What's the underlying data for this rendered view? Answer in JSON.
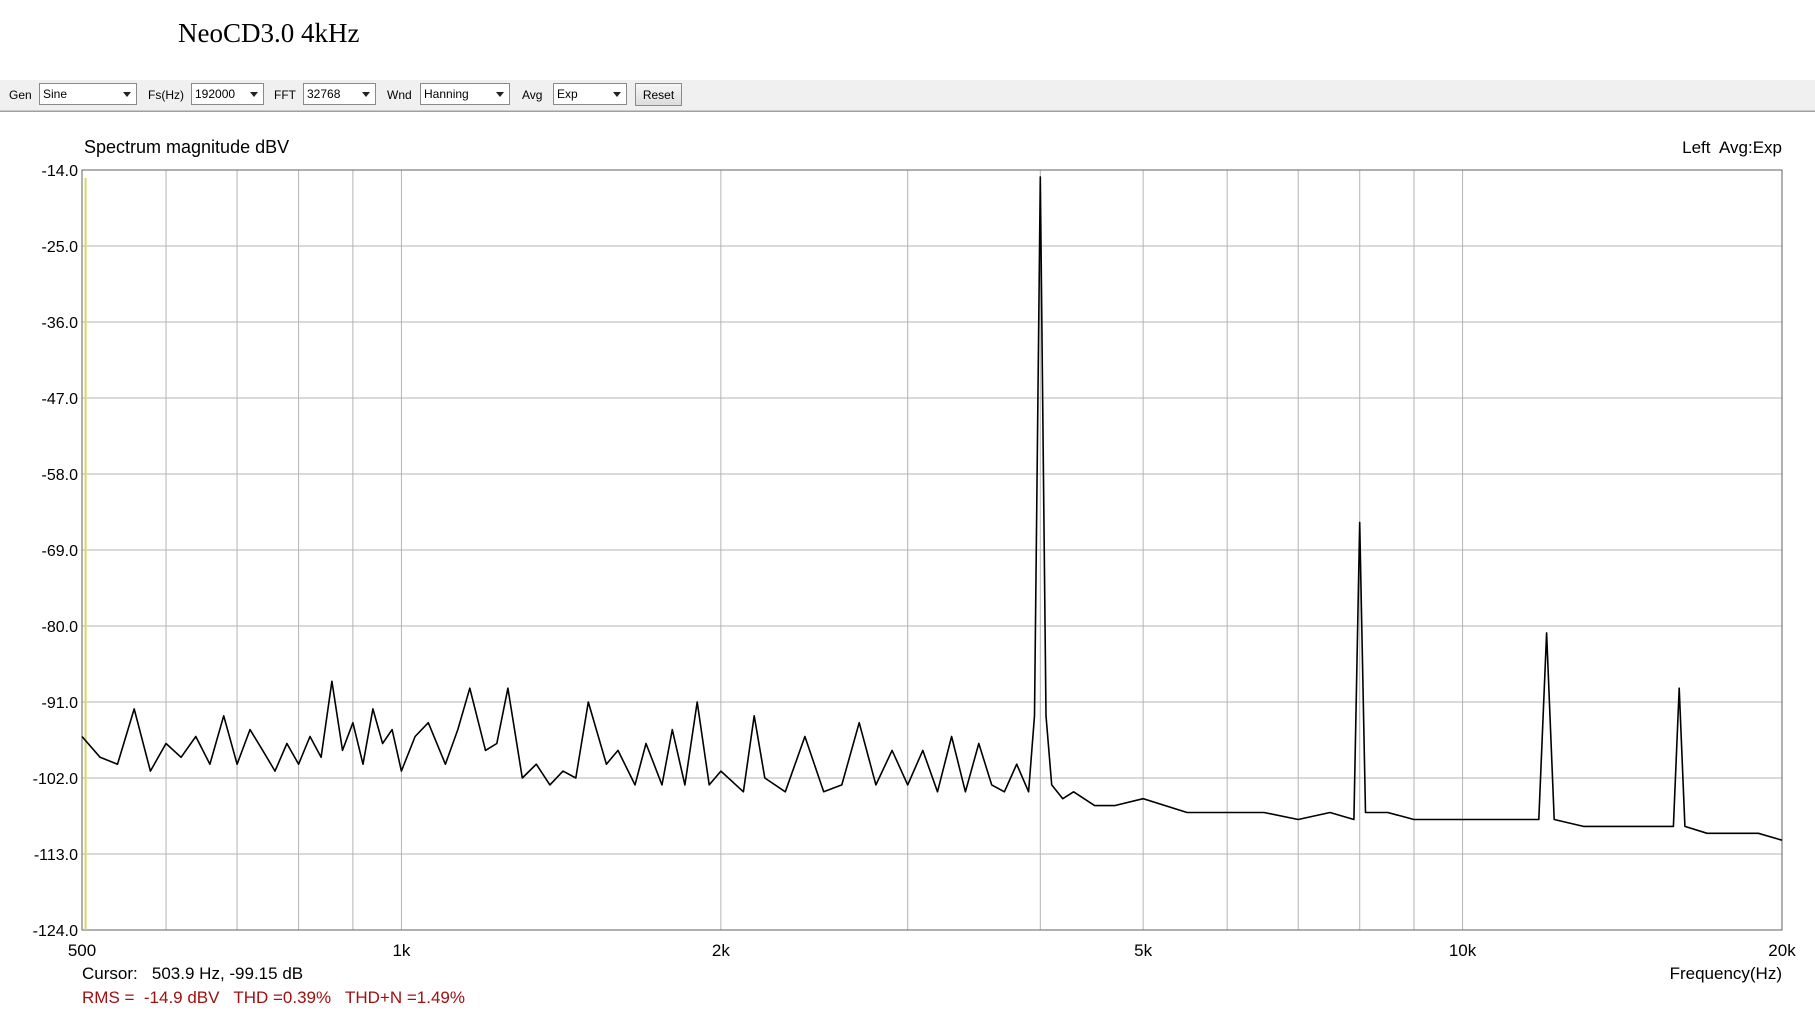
{
  "page_title": "NeoCD3.0 4kHz",
  "toolbar": {
    "gen_label": "Gen",
    "gen_value": "Sine",
    "fs_label": "Fs(Hz)",
    "fs_value": "192000",
    "fft_label": "FFT",
    "fft_value": "32768",
    "wnd_label": "Wnd",
    "wnd_value": "Hanning",
    "avg_label": "Avg",
    "avg_value": "Exp",
    "reset_label": "Reset"
  },
  "chart_data": {
    "type": "line",
    "title": "Spectrum magnitude dBV",
    "channel_label": "Left  Avg:Exp",
    "xlabel": "Frequency(Hz)",
    "xscale": "log",
    "xlim": [
      500,
      20000
    ],
    "ylim": [
      -124,
      -14
    ],
    "yticks": [
      -14.0,
      -25.0,
      -36.0,
      -47.0,
      -58.0,
      -69.0,
      -80.0,
      -91.0,
      -102.0,
      -113.0,
      -124.0
    ],
    "ytick_labels": [
      "-14.0",
      "-25.0",
      "-36.0",
      "-47.0",
      "-58.0",
      "-69.0",
      "-80.0",
      "-91.0",
      "-102.0",
      "-113.0",
      "-124.0"
    ],
    "xticks": [
      500,
      1000,
      2000,
      5000,
      10000,
      20000
    ],
    "xtick_labels": [
      "500",
      "1k",
      "2k",
      "5k",
      "10k",
      "20k"
    ],
    "xgrid": [
      600,
      700,
      800,
      900,
      1000,
      2000,
      3000,
      4000,
      5000,
      6000,
      7000,
      8000,
      9000,
      10000
    ],
    "grid": true,
    "line_color": "#000000",
    "cursor_marker_color": "#d8d860",
    "series": [
      {
        "x": [
          500,
          520,
          540,
          560,
          580,
          600,
          620,
          640,
          660,
          680,
          700,
          720,
          740,
          760,
          780,
          800,
          820,
          840,
          860,
          880,
          900,
          920,
          940,
          960,
          980,
          1000,
          1030,
          1060,
          1100,
          1130,
          1160,
          1200,
          1230,
          1260,
          1300,
          1340,
          1380,
          1420,
          1460,
          1500,
          1560,
          1600,
          1660,
          1700,
          1760,
          1800,
          1850,
          1900,
          1950,
          2000,
          2100,
          2150,
          2200,
          2300,
          2400,
          2500,
          2600,
          2700,
          2800,
          2900,
          3000,
          3100,
          3200,
          3300,
          3400,
          3500,
          3600,
          3700,
          3800,
          3900,
          3950,
          4000,
          4050,
          4100,
          4200,
          4300,
          4500,
          4700,
          5000,
          5500,
          6000,
          6500,
          7000,
          7500,
          7900,
          8000,
          8100,
          8500,
          9000,
          10000,
          11000,
          11800,
          12000,
          12200,
          13000,
          14000,
          15000,
          15800,
          16000,
          16200,
          17000,
          18000,
          19000,
          20000
        ],
        "y": [
          -96,
          -99,
          -100,
          -92,
          -101,
          -97,
          -99,
          -96,
          -100,
          -93,
          -100,
          -95,
          -98,
          -101,
          -97,
          -100,
          -96,
          -99,
          -88,
          -98,
          -94,
          -100,
          -92,
          -97,
          -95,
          -101,
          -96,
          -94,
          -100,
          -95,
          -89,
          -98,
          -97,
          -89,
          -102,
          -100,
          -103,
          -101,
          -102,
          -91,
          -100,
          -98,
          -103,
          -97,
          -103,
          -95,
          -103,
          -91,
          -103,
          -101,
          -104,
          -93,
          -102,
          -104,
          -96,
          -104,
          -103,
          -94,
          -103,
          -98,
          -103,
          -98,
          -104,
          -96,
          -104,
          -97,
          -103,
          -104,
          -100,
          -104,
          -93,
          -15,
          -93,
          -103,
          -105,
          -104,
          -106,
          -106,
          -105,
          -107,
          -107,
          -107,
          -108,
          -107,
          -108,
          -65,
          -107,
          -107,
          -108,
          -108,
          -108,
          -108,
          -81,
          -108,
          -109,
          -109,
          -109,
          -109,
          -89,
          -109,
          -110,
          -110,
          -110,
          -111
        ]
      }
    ],
    "cursor_text": "Cursor:   503.9 Hz, -99.15 dB",
    "stats_text": "RMS =  -14.9 dBV   THD =0.39%   THD+N =1.49%",
    "stats_color": "#a01010"
  }
}
